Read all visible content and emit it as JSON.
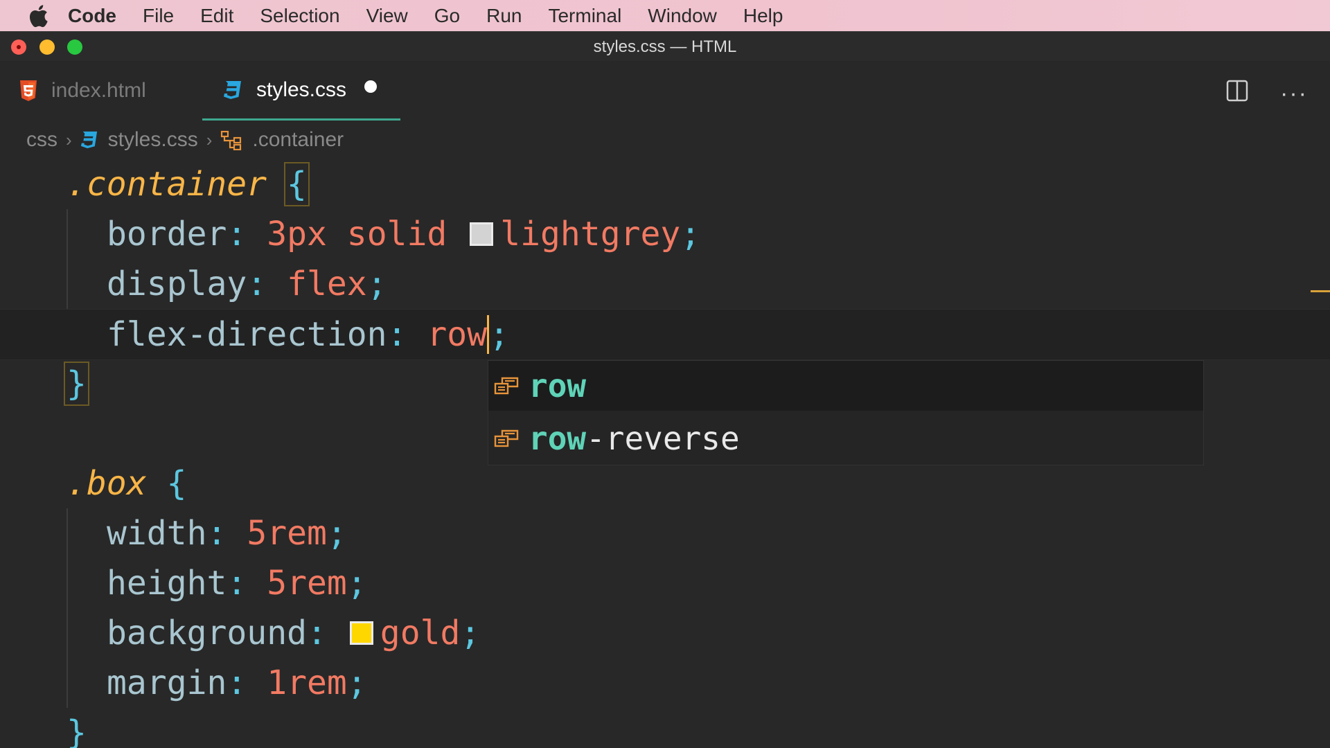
{
  "menubar": {
    "app": "Code",
    "items": [
      "File",
      "Edit",
      "Selection",
      "View",
      "Go",
      "Run",
      "Terminal",
      "Window",
      "Help"
    ]
  },
  "window": {
    "title": "styles.css — HTML"
  },
  "tabs": [
    {
      "label": "index.html",
      "icon": "html5-icon",
      "active": false
    },
    {
      "label": "styles.css",
      "icon": "css3-icon",
      "active": true,
      "dirty": true
    }
  ],
  "breadcrumb": {
    "folder": "css",
    "file": "styles.css",
    "symbol": ".container"
  },
  "code": {
    "rule1": {
      "selector": ".container",
      "border_prop": "border",
      "border_val": "3px solid",
      "border_color": "lightgrey",
      "display_prop": "display",
      "display_val": "flex",
      "flexdir_prop": "flex-direction",
      "flexdir_val": "row"
    },
    "rule2": {
      "selector": ".box",
      "width_prop": "width",
      "width_val": "5rem",
      "height_prop": "height",
      "height_val": "5rem",
      "bg_prop": "background",
      "bg_val": "gold",
      "margin_prop": "margin",
      "margin_val": "1rem"
    },
    "open_brace": "{",
    "close_brace": "}",
    "colon": ":",
    "semicolon": ";"
  },
  "suggestions": [
    {
      "match": "row",
      "rest": "",
      "icon": "enum-value-icon",
      "selected": true
    },
    {
      "match": "row",
      "rest": "-reverse",
      "icon": "enum-value-icon",
      "selected": false
    }
  ],
  "colors": {
    "accent_tab_underline": "#3fa88f",
    "selector": "#f8b547",
    "property": "#a9c6d0",
    "value": "#f27a63",
    "punctuation": "#5cc7e0",
    "swatch_lightgrey": "#d3d3d3",
    "swatch_gold": "#ffd700"
  }
}
